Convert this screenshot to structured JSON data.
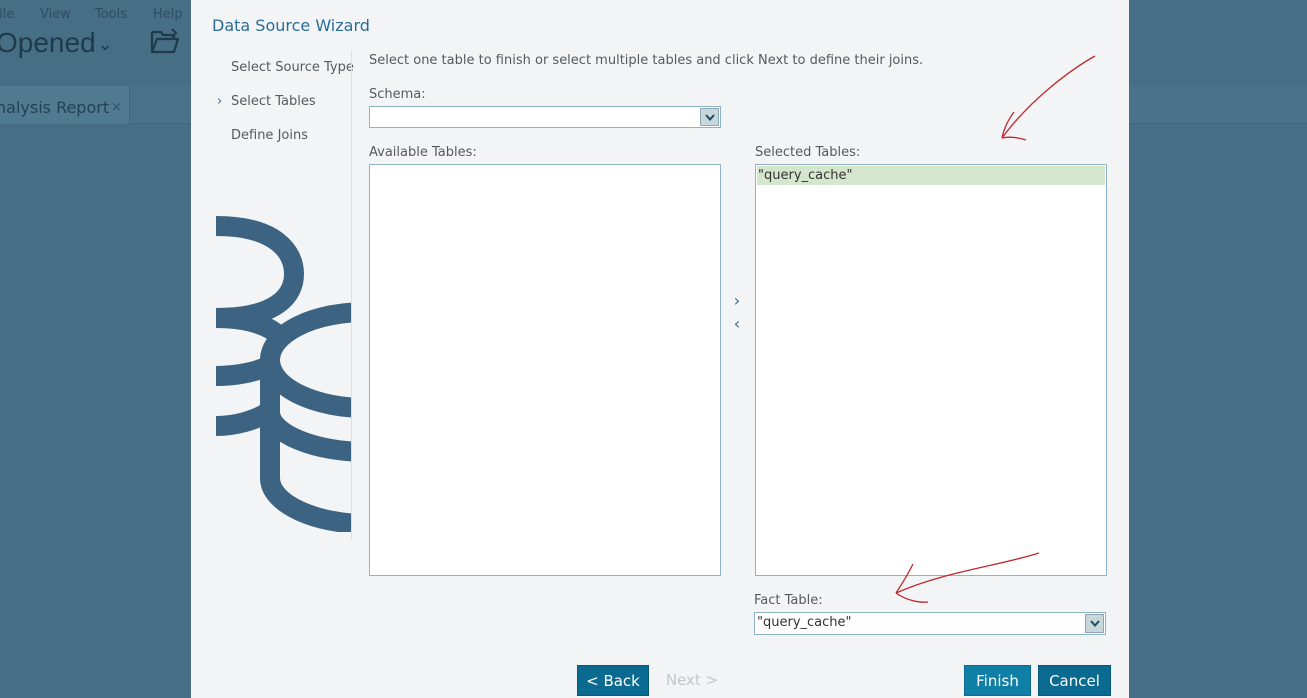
{
  "background_app": {
    "menu": [
      "ile",
      "View",
      "Tools",
      "Help"
    ],
    "opened_label": "Opened",
    "tab_label": "nalysis Report",
    "tab_close": "×"
  },
  "dialog": {
    "title": "Data Source Wizard",
    "steps": [
      {
        "label": "Select Source Type",
        "active": false
      },
      {
        "label": "Select Tables",
        "active": true
      },
      {
        "label": "Define Joins",
        "active": false
      }
    ],
    "active_step_marker": "›",
    "instructions": "Select one table to finish or select multiple tables and click Next to define their joins.",
    "schema": {
      "label": "Schema:",
      "value": ""
    },
    "available_tables": {
      "label": "Available Tables:",
      "items": []
    },
    "selected_tables": {
      "label": "Selected Tables:",
      "items": [
        "\"query_cache\""
      ]
    },
    "move_right": "›",
    "move_left": "‹",
    "fact_table": {
      "label": "Fact Table:",
      "value": "\"query_cache\""
    },
    "buttons": {
      "back": "< Back",
      "next": "Next >",
      "finish": "Finish",
      "cancel": "Cancel"
    }
  },
  "colors": {
    "dialog_bg": "#f3f4f6",
    "accent": "#2a6d96",
    "button_primary": "#0a6a8f",
    "selected_row": "#d4e6cc",
    "annotation_red": "#c0272d",
    "overlay_bg": "#466e84"
  }
}
